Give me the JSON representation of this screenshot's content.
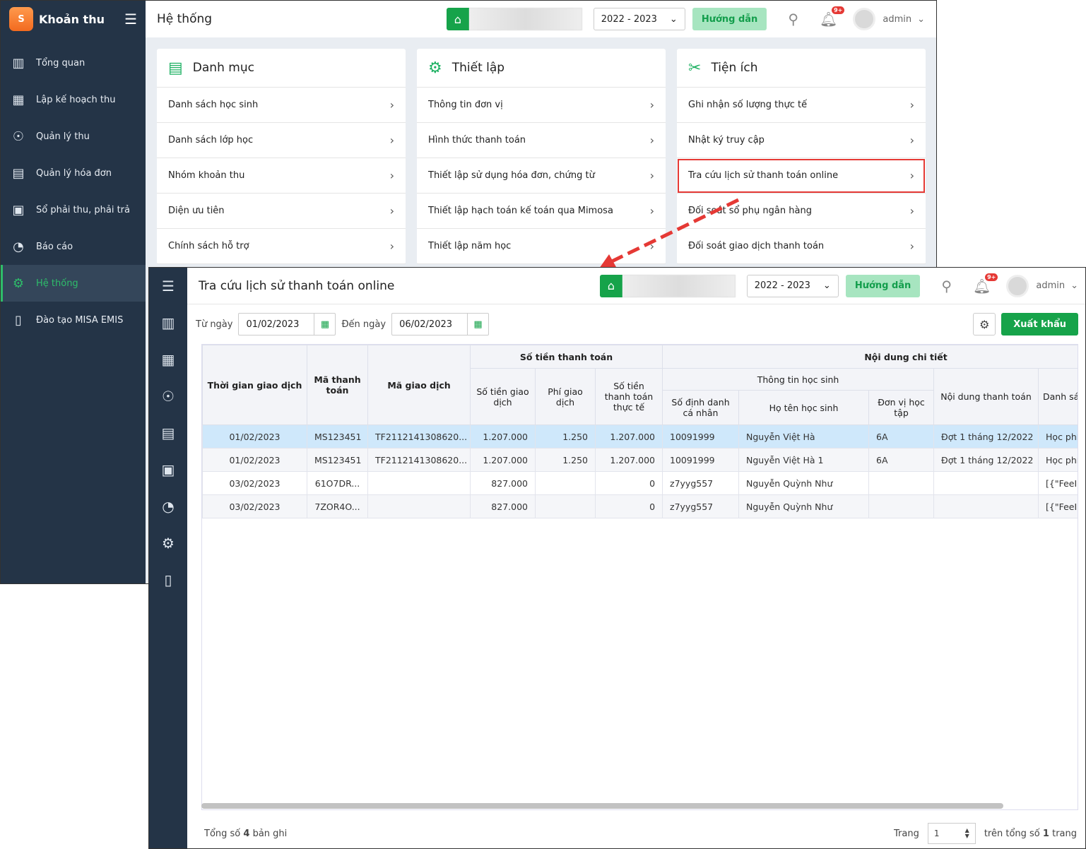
{
  "back": {
    "app_title": "Khoản thu",
    "page_title": "Hệ thống",
    "year": "2022 - 2023",
    "guide": "Hướng dẫn",
    "user": "admin",
    "badge": "9+",
    "nav": [
      "Tổng quan",
      "Lập kế hoạch thu",
      "Quản lý thu",
      "Quản lý hóa đơn",
      "Sổ phải thu, phải trả",
      "Báo cáo",
      "Hệ thống",
      "Đào tạo MISA EMIS"
    ],
    "cards": [
      {
        "title": "Danh mục",
        "items": [
          "Danh sách học sinh",
          "Danh sách lớp học",
          "Nhóm khoản thu",
          "Diện ưu tiên",
          "Chính sách hỗ trợ"
        ]
      },
      {
        "title": "Thiết lập",
        "items": [
          "Thông tin đơn vị",
          "Hình thức thanh toán",
          "Thiết lập sử dụng hóa đơn, chứng từ",
          "Thiết lập hạch toán kế toán qua Mimosa",
          "Thiết lập năm học"
        ]
      },
      {
        "title": "Tiện ích",
        "items": [
          "Ghi nhận số lượng thực tế",
          "Nhật ký truy cập",
          "Tra cứu lịch sử thanh toán online",
          "Đối soát sổ phụ ngân hàng",
          "Đối soát giao dịch thanh toán"
        ]
      }
    ]
  },
  "front": {
    "page_title": "Tra cứu lịch sử thanh toán online",
    "year": "2022 - 2023",
    "guide": "Hướng dẫn",
    "user": "admin",
    "badge": "9+",
    "from_label": "Từ ngày",
    "from": "01/02/2023",
    "to_label": "Đến ngày",
    "to": "06/02/2023",
    "export": "Xuất khẩu",
    "headers": {
      "time": "Thời gian giao dịch",
      "pay_code": "Mã thanh toán",
      "tx_code": "Mã giao dịch",
      "amount_group": "Số tiền thanh toán",
      "amount": "Số tiền giao dịch",
      "fee": "Phí giao dịch",
      "actual": "Số tiền thanh toán thực tế",
      "detail_group": "Nội dung chi tiết",
      "student_group": "Thông tin học sinh",
      "id": "Số định danh cá nhân",
      "name": "Họ tên học sinh",
      "unit": "Đơn vị học tập",
      "content": "Nội dung thanh toán",
      "list": "Danh sách n"
    },
    "rows": [
      {
        "time": "01/02/2023",
        "pay_code": "MS123451",
        "tx_code": "TF2112141308620...",
        "amount": "1.207.000",
        "fee": "1.250",
        "actual": "1.207.000",
        "id": "10091999",
        "name": "Nguyễn Việt Hà",
        "unit": "6A",
        "content": "Đợt 1 tháng 12/2022",
        "list": "Học phí"
      },
      {
        "time": "01/02/2023",
        "pay_code": "MS123451",
        "tx_code": "TF2112141308620...",
        "amount": "1.207.000",
        "fee": "1.250",
        "actual": "1.207.000",
        "id": "10091999",
        "name": "Nguyễn Việt Hà 1",
        "unit": "6A",
        "content": "Đợt 1 tháng 12/2022",
        "list": "Học phí"
      },
      {
        "time": "03/02/2023",
        "pay_code": "61O7DR...",
        "tx_code": "",
        "amount": "827.000",
        "fee": "",
        "actual": "0",
        "id": "z7yyg557",
        "name": "Nguyễn Quỳnh Như",
        "unit": "",
        "content": "",
        "list": "[{\"FeeID"
      },
      {
        "time": "03/02/2023",
        "pay_code": "7ZOR4O...",
        "tx_code": "",
        "amount": "827.000",
        "fee": "",
        "actual": "0",
        "id": "z7yyg557",
        "name": "Nguyễn Quỳnh Như",
        "unit": "",
        "content": "",
        "list": "[{\"FeeID"
      }
    ],
    "total_prefix": "Tổng số",
    "total": "4",
    "total_suffix": "bản ghi",
    "page_label": "Trang",
    "page": "1",
    "pages_prefix": "trên tổng số",
    "pages": "1",
    "pages_suffix": "trang"
  },
  "colors": {
    "sidebar": "#243447",
    "accent": "#16a34a",
    "highlight": "#e53935",
    "selected_row": "#cfe8fb"
  }
}
